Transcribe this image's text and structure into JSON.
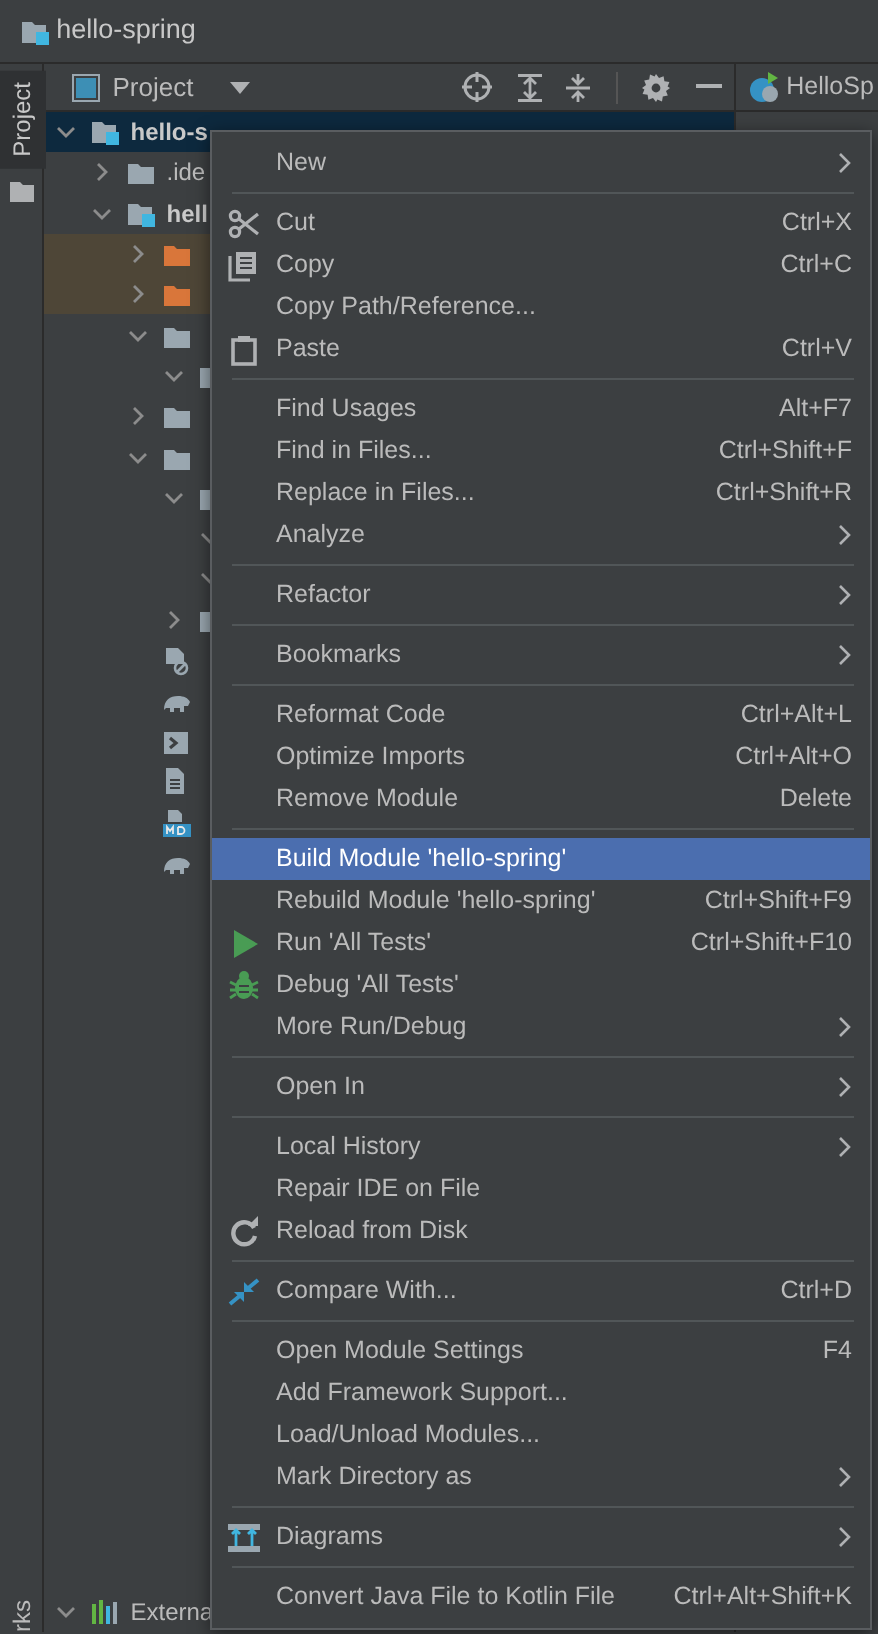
{
  "window": {
    "title": "hello-spring"
  },
  "side_strip": {
    "tab_label": "Project",
    "tab_selected": true,
    "bottom_label": "rks"
  },
  "tool_window": {
    "title": "Project"
  },
  "editor_tab": {
    "label": "HelloSp"
  },
  "tree": [
    {
      "kind": "module",
      "label": "hello-s",
      "expanded": true,
      "selected": true,
      "children": [
        {
          "kind": "folder",
          "label": ".ide",
          "expanded": false,
          "selected": false
        },
        {
          "kind": "module",
          "label": "hell",
          "expanded": true,
          "selected": false,
          "children": [
            {
              "kind": "excluded-folder",
              "expanded": false,
              "selected": false
            },
            {
              "kind": "excluded-folder",
              "expanded": false,
              "selected": false
            },
            {
              "kind": "folder",
              "expanded": true,
              "selected": false,
              "children": [
                {
                  "kind": "folder",
                  "expanded": true,
                  "selected": false
                }
              ]
            },
            {
              "kind": "folder",
              "expanded": false,
              "selected": false
            },
            {
              "kind": "folder",
              "expanded": true,
              "selected": false,
              "children": [
                {
                  "kind": "folder",
                  "expanded": true,
                  "selected": false,
                  "children": [
                    {
                      "expanded": true,
                      "selected": false
                    },
                    {
                      "expanded": true,
                      "selected": false
                    }
                  ]
                },
                {
                  "kind": "folder",
                  "expanded": false,
                  "selected": false
                }
              ]
            },
            {
              "kind": "ignore-file",
              "selected": false
            },
            {
              "kind": "gradle-file",
              "selected": false
            },
            {
              "kind": "script-file",
              "selected": false
            },
            {
              "kind": "text-file",
              "selected": false
            },
            {
              "kind": "markdown-file",
              "selected": false
            },
            {
              "kind": "gradle-file",
              "selected": false
            }
          ]
        }
      ]
    },
    {
      "kind": "library",
      "label": "Externa",
      "expanded": true,
      "selected": false
    }
  ],
  "context_menu": [
    {
      "kind": "item",
      "label": "New",
      "submenu": true,
      "selected": false
    },
    {
      "kind": "separator"
    },
    {
      "kind": "cut",
      "label": "Cut",
      "shortcut": "Ctrl+X",
      "selected": false
    },
    {
      "kind": "copy",
      "label": "Copy",
      "shortcut": "Ctrl+C",
      "selected": false
    },
    {
      "kind": "item",
      "label": "Copy Path/Reference...",
      "selected": false
    },
    {
      "kind": "paste",
      "label": "Paste",
      "shortcut": "Ctrl+V",
      "selected": false
    },
    {
      "kind": "separator"
    },
    {
      "kind": "item",
      "label": "Find Usages",
      "shortcut": "Alt+F7",
      "selected": false
    },
    {
      "kind": "item",
      "label": "Find in Files...",
      "shortcut": "Ctrl+Shift+F",
      "selected": false
    },
    {
      "kind": "item",
      "label": "Replace in Files...",
      "shortcut": "Ctrl+Shift+R",
      "selected": false
    },
    {
      "kind": "item",
      "label": "Analyze",
      "submenu": true,
      "selected": false
    },
    {
      "kind": "separator"
    },
    {
      "kind": "item",
      "label": "Refactor",
      "submenu": true,
      "selected": false
    },
    {
      "kind": "separator"
    },
    {
      "kind": "item",
      "label": "Bookmarks",
      "submenu": true,
      "selected": false
    },
    {
      "kind": "separator"
    },
    {
      "kind": "item",
      "label": "Reformat Code",
      "shortcut": "Ctrl+Alt+L",
      "selected": false
    },
    {
      "kind": "item",
      "label": "Optimize Imports",
      "shortcut": "Ctrl+Alt+O",
      "selected": false
    },
    {
      "kind": "item",
      "label": "Remove Module",
      "shortcut": "Delete",
      "selected": false
    },
    {
      "kind": "separator"
    },
    {
      "kind": "item",
      "label": "Build Module 'hello-spring'",
      "selected": true
    },
    {
      "kind": "item",
      "label": "Rebuild Module 'hello-spring'",
      "shortcut": "Ctrl+Shift+F9",
      "selected": false
    },
    {
      "kind": "run",
      "label": "Run 'All Tests'",
      "shortcut": "Ctrl+Shift+F10",
      "selected": false
    },
    {
      "kind": "debug",
      "label": "Debug 'All Tests'",
      "selected": false
    },
    {
      "kind": "item",
      "label": "More Run/Debug",
      "submenu": true,
      "selected": false
    },
    {
      "kind": "separator"
    },
    {
      "kind": "item",
      "label": "Open In",
      "submenu": true,
      "selected": false
    },
    {
      "kind": "separator"
    },
    {
      "kind": "item",
      "label": "Local History",
      "submenu": true,
      "selected": false
    },
    {
      "kind": "item",
      "label": "Repair IDE on File",
      "selected": false
    },
    {
      "kind": "reload",
      "label": "Reload from Disk",
      "selected": false
    },
    {
      "kind": "separator"
    },
    {
      "kind": "compare",
      "label": "Compare With...",
      "shortcut": "Ctrl+D",
      "selected": false
    },
    {
      "kind": "separator"
    },
    {
      "kind": "item",
      "label": "Open Module Settings",
      "shortcut": "F4",
      "selected": false
    },
    {
      "kind": "item",
      "label": "Add Framework Support...",
      "selected": false
    },
    {
      "kind": "item",
      "label": "Load/Unload Modules...",
      "selected": false
    },
    {
      "kind": "item",
      "label": "Mark Directory as",
      "submenu": true,
      "selected": false
    },
    {
      "kind": "separator"
    },
    {
      "kind": "diagrams",
      "label": "Diagrams",
      "submenu": true,
      "selected": false
    },
    {
      "kind": "separator"
    },
    {
      "kind": "item",
      "label": "Convert Java File to Kotlin File",
      "shortcut": "Ctrl+Alt+Shift+K",
      "selected": false
    }
  ]
}
